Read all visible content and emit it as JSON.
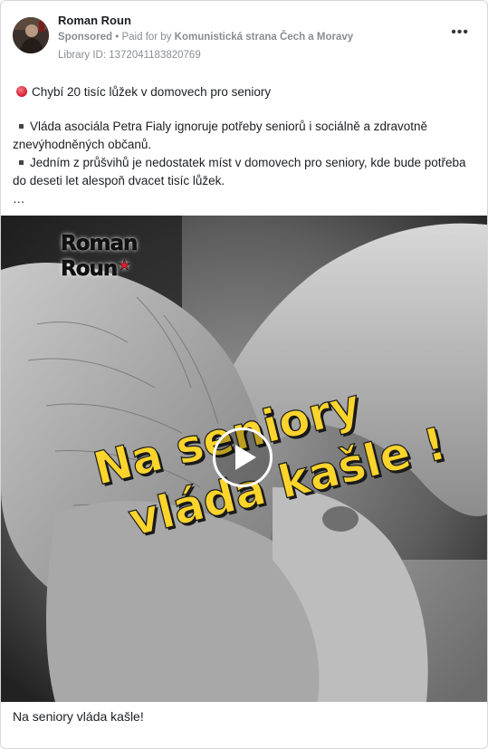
{
  "header": {
    "page_name": "Roman Roun",
    "sponsored_label": "Sponsored",
    "separator": " • ",
    "paid_for_by": "Paid for by ",
    "funder": "Komunistická strana Čech a Moravy",
    "library_id": "Library ID: 1372041183820769",
    "more_icon": "more-horizontal-icon",
    "more_label": "•••"
  },
  "ad_text": {
    "lead": "Chybí 20 tisíc lůžek v domovech pro seniory",
    "bullet_1": "Vláda asociála Petra Fialy ignoruje potřeby seniorů i sociálně a zdravotně znevýhodněných občanů.",
    "bullet_2": "Jedním z průšvihů je nedostatek míst v domovech pro seniory, kde bude potřeba do deseti let alespoň dvacet tisíc lůžek.",
    "ellipsis": "…"
  },
  "media": {
    "logo_line_1": "Roman",
    "logo_line_2": "Roun",
    "logo_star": "★",
    "headline_line_1": "Na seniory",
    "headline_line_2": "vláda kašle !",
    "play_icon": "play-icon",
    "headline_color": "#fbd42c"
  },
  "caption": "Na seniory vláda kašle!"
}
